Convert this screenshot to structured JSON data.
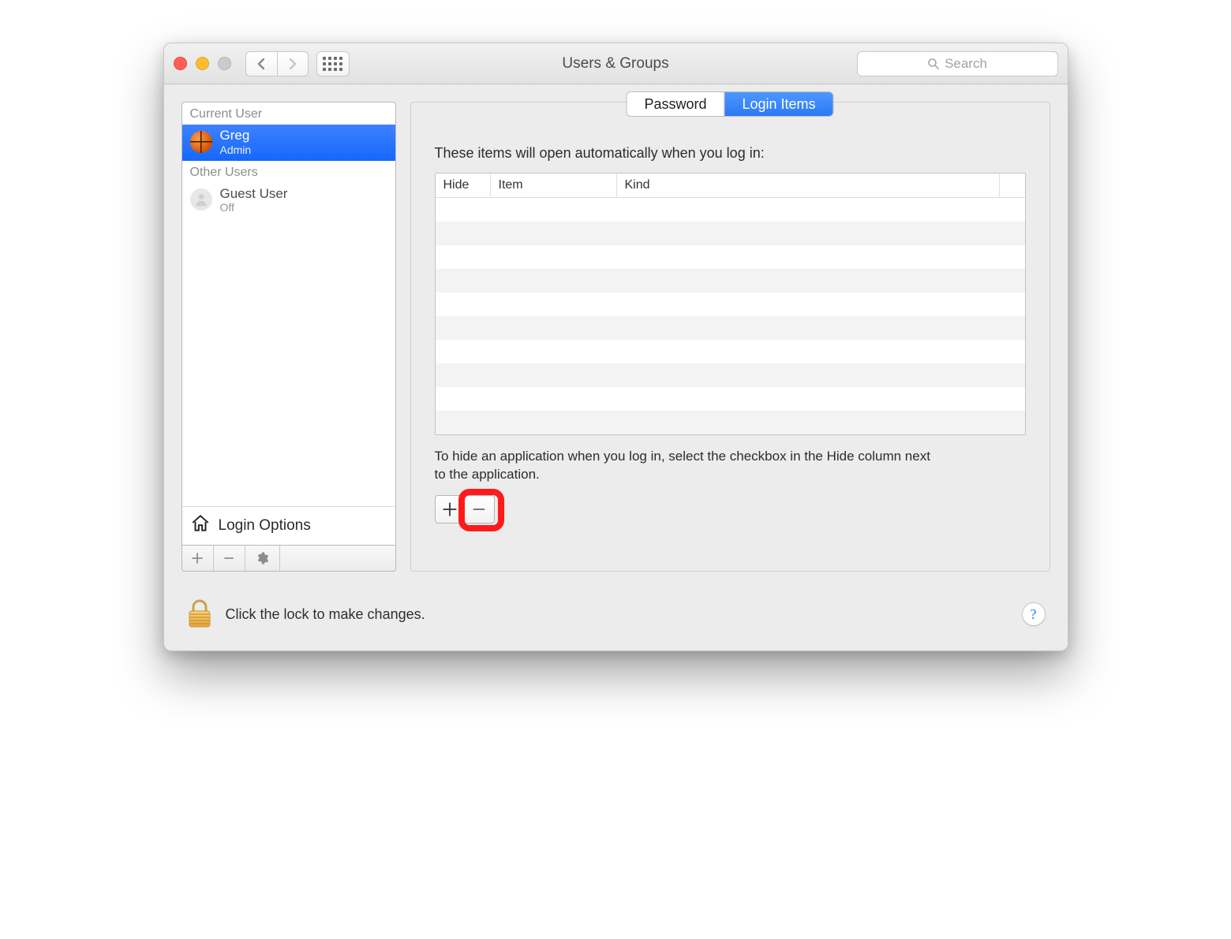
{
  "window": {
    "title": "Users & Groups"
  },
  "toolbar": {
    "search_placeholder": "Search"
  },
  "tabs": {
    "password": "Password",
    "login_items": "Login Items",
    "active": "login_items"
  },
  "sidebar": {
    "current_label": "Current User",
    "other_label": "Other Users",
    "current_user": {
      "name": "Greg",
      "role": "Admin"
    },
    "other_user": {
      "name": "Guest User",
      "role": "Off"
    },
    "login_options": "Login Options"
  },
  "main": {
    "description": "These items will open automatically when you log in:",
    "columns": {
      "hide": "Hide",
      "item": "Item",
      "kind": "Kind"
    },
    "hint": "To hide an application when you log in, select the checkbox in the Hide column next to the application."
  },
  "footer": {
    "lock_text": "Click the lock to make changes."
  },
  "annotations": {
    "remove_button_highlighted": true
  }
}
